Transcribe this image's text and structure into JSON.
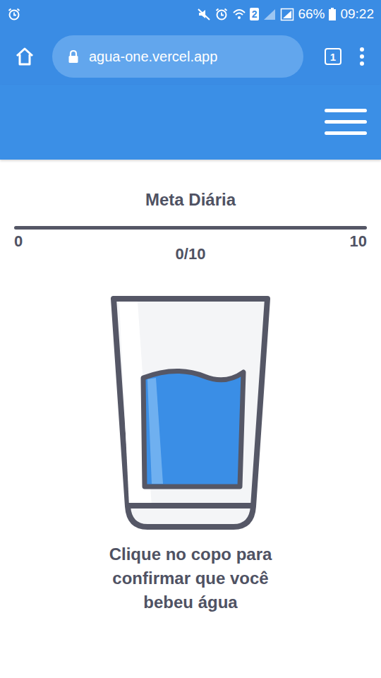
{
  "status_bar": {
    "sim": "2",
    "battery": "66%",
    "time": "09:22"
  },
  "browser": {
    "url": "agua-one.vercel.app",
    "tab_count": "1"
  },
  "goal": {
    "title": "Meta Diária",
    "min": "0",
    "max": "10",
    "count": "0/10",
    "level": 0
  },
  "glass": {
    "caption_lines": [
      "Clique no copo para",
      "confirmar que você",
      "bebeu água"
    ]
  }
}
